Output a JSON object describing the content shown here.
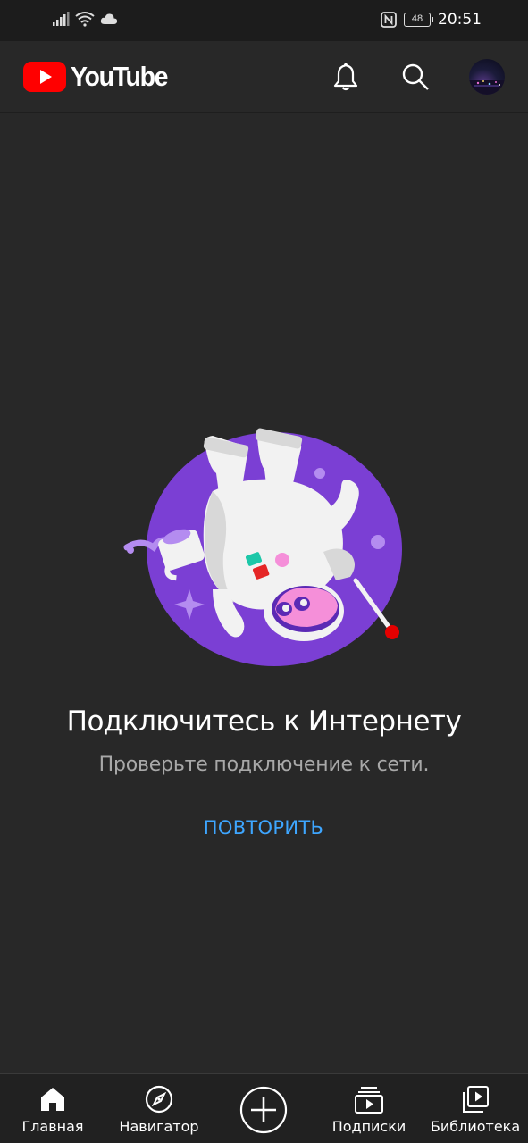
{
  "status_bar": {
    "battery": "48",
    "time": "20:51"
  },
  "header": {
    "logo_text": "YouTube",
    "icons": [
      "bell-icon",
      "search-icon",
      "avatar"
    ]
  },
  "empty_state": {
    "title": "Подключитесь к Интернету",
    "subtitle": "Проверьте подключение к сети.",
    "retry_label": "ПОВТОРИТЬ"
  },
  "bottom_nav": {
    "items": [
      {
        "label": "Главная",
        "icon": "home-icon"
      },
      {
        "label": "Навигатор",
        "icon": "compass-icon"
      },
      {
        "label": "",
        "icon": "create-icon"
      },
      {
        "label": "Подписки",
        "icon": "subscriptions-icon"
      },
      {
        "label": "Библиотека",
        "icon": "library-icon"
      }
    ]
  },
  "colors": {
    "background": "#282828",
    "brand_red": "#ff0000",
    "accent_blue": "#3ea6ff",
    "illustration_purple": "#7b3fd4"
  }
}
